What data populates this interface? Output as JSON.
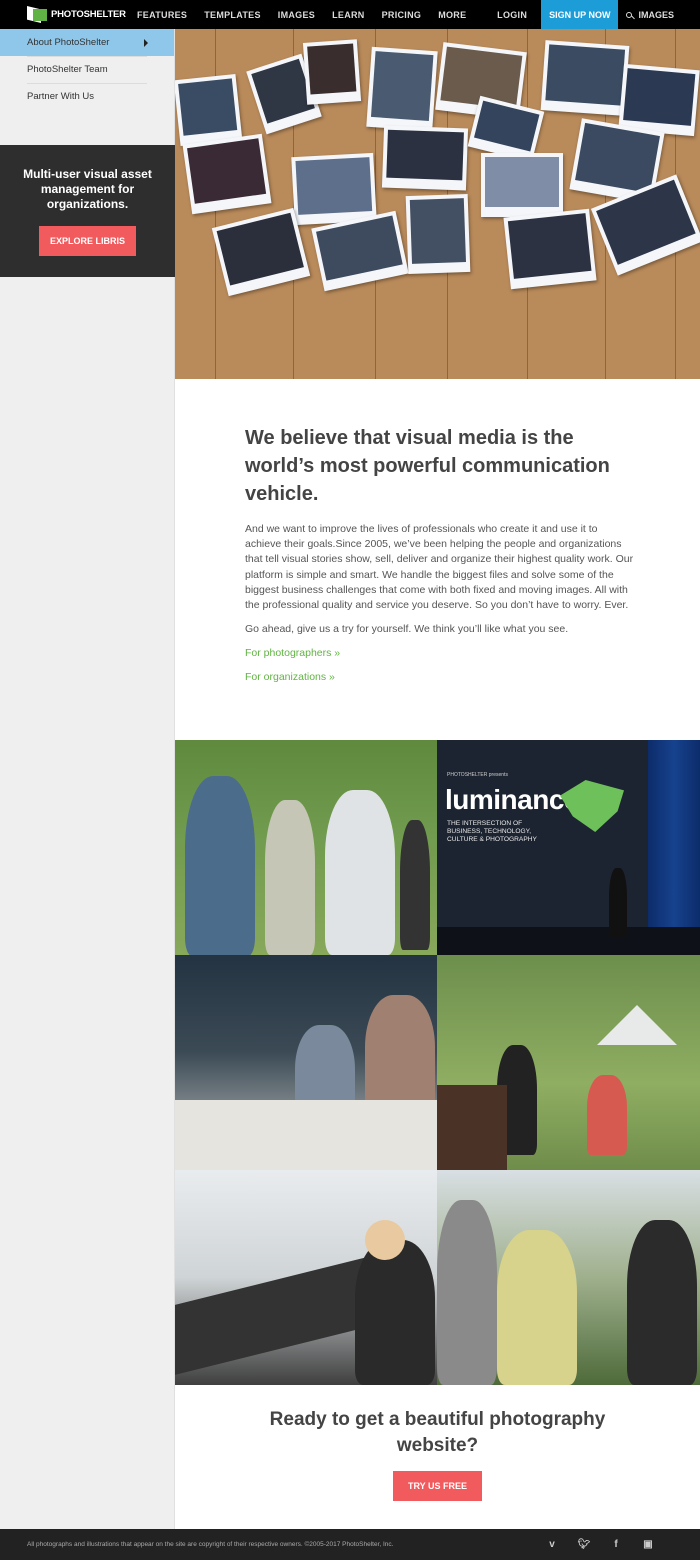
{
  "nav": {
    "logo_text": "PHOTOSHELTER",
    "links": [
      "FEATURES",
      "TEMPLATES",
      "IMAGES",
      "LEARN",
      "PRICING",
      "MORE"
    ],
    "login": "LOGIN",
    "signup": "SIGN UP NOW",
    "images": "IMAGES"
  },
  "sidebar": {
    "items": [
      {
        "label": "About PhotoShelter"
      },
      {
        "label": "PhotoShelter Team"
      },
      {
        "label": "Partner With Us"
      }
    ],
    "promo": {
      "text": "Multi-user visual asset management for organizations.",
      "button": "EXPLORE LIBRIS"
    }
  },
  "main": {
    "headline": "We believe that visual media is the world’s most powerful communication vehicle.",
    "paragraph": "And we want to improve the lives of professionals who create it and use it to achieve their goals.Since 2005, we’ve been helping the people and organizations that tell visual stories show, sell, deliver and organize their highest quality work. Our platform is simple and smart. We handle the biggest files and solve some of the biggest business challenges that come with both fixed and moving images. All with the professional quality and service you deserve. So you don’t have to worry. Ever.",
    "paragraph2": "Go ahead, give us a try for yourself. We think you’ll like what you see.",
    "link_photographers": "For photographers »",
    "link_organizations": "For organizations »",
    "luminance": {
      "presents": "PHOTOSHELTER presents",
      "title": "luminance",
      "subtitle": "THE INTERSECTION OF BUSINESS, TECHNOLOGY, CULTURE & PHOTOGRAPHY"
    },
    "cta_title": "Ready to get a beautiful photography website?",
    "cta_button": "TRY US FREE"
  },
  "footer": {
    "copyright": "All photographs and illustrations that appear on the site are copyright of their respective owners. ©2005-2017 PhotoShelter, Inc.",
    "social": [
      "vimeo-icon",
      "twitter-icon",
      "facebook-icon",
      "instagram-icon"
    ]
  },
  "colors": {
    "signup": "#1d9dd8",
    "accent_red": "#f15b5e",
    "link_green": "#62b345",
    "sidebar_active": "#8fc7ea"
  }
}
